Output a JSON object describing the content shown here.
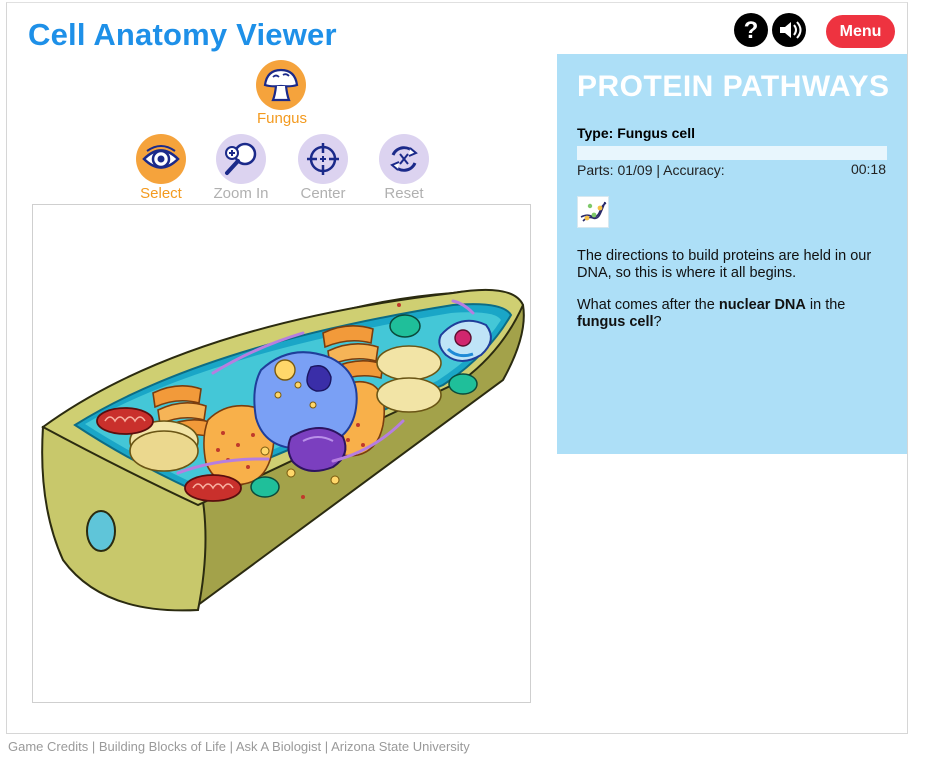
{
  "app": {
    "title": "Cell Anatomy Viewer"
  },
  "header": {
    "menu_label": "Menu",
    "help_icon": "question-icon",
    "sound_icon": "speaker-icon"
  },
  "organism": {
    "label": "Fungus",
    "icon": "mushroom-icon"
  },
  "tools": [
    {
      "label": "Select",
      "icon": "eye-icon",
      "active": true
    },
    {
      "label": "Zoom In",
      "icon": "magnifier-plus-icon",
      "active": false
    },
    {
      "label": "Center",
      "icon": "crosshair-icon",
      "active": false
    },
    {
      "label": "Reset",
      "icon": "reset-arrows-icon",
      "active": false
    }
  ],
  "panel": {
    "title": "PROTEIN PATHWAYS",
    "type_line": "Type: Fungus cell",
    "parts": "Parts: 01/09 | Accuracy:",
    "timer": "00:18",
    "progress": 0.0,
    "thumb_icon": "dna-icon",
    "p1": "The directions to build proteins are held in our DNA, so this is where it all begins.",
    "q_prefix": "What comes after the ",
    "q_bold1": "nuclear DNA",
    "q_mid": " in the ",
    "q_bold2": "fungus cell",
    "q_suffix": "?"
  },
  "footer": {
    "links": [
      "Game Credits",
      "Building Blocks of Life",
      "Ask A Biologist",
      "Arizona State University"
    ],
    "separator": " | "
  },
  "colors": {
    "title_blue": "#1e90e8",
    "menu_red": "#ee3340",
    "orange": "#f5a33c",
    "tool_inactive_bg": "#dcd3f0",
    "tool_label_inactive": "#b0b0b0",
    "panel_bg": "#addff7"
  }
}
